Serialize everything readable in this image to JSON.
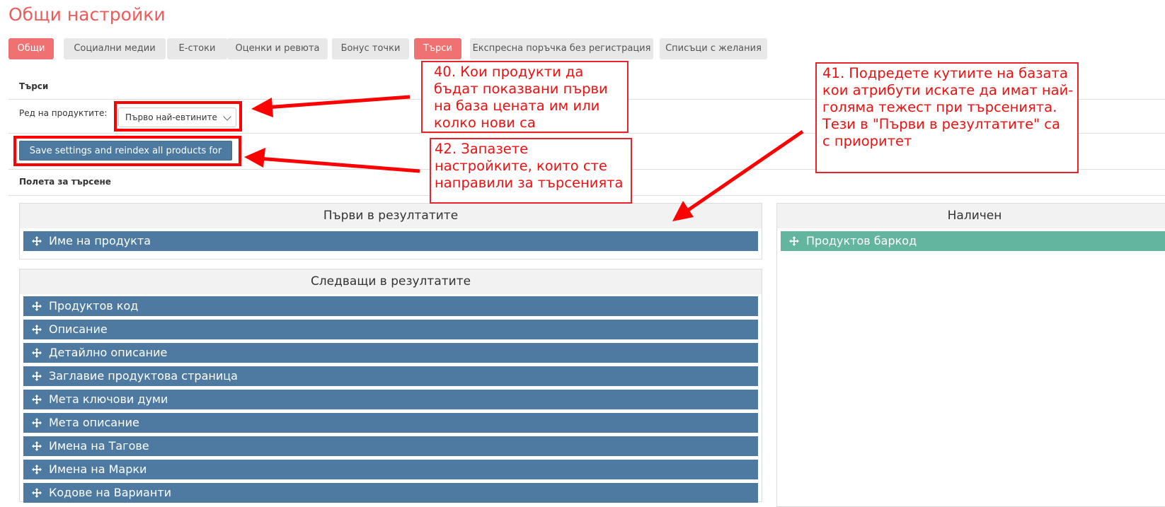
{
  "page": {
    "title": "Общи настройки"
  },
  "tabs": [
    {
      "label": "Общи",
      "active": true
    },
    {
      "label": "Социални медии",
      "active": false
    },
    {
      "label": "Е-стоки",
      "active": false
    },
    {
      "label": "Оценки и ревюта",
      "active": false
    },
    {
      "label": "Бонус точки",
      "active": false
    },
    {
      "label": "Търси",
      "active": true
    },
    {
      "label": "Експресна поръчка без регистрация",
      "active": false
    },
    {
      "label": "Списъци с желания",
      "active": false
    }
  ],
  "search_section": {
    "title": "Търси",
    "order_label": "Ред на продуктите:",
    "order_value": "Първо най-евтините",
    "save_button": "Save settings and reindex all products for search"
  },
  "fields_section": {
    "title": "Полета за търсене",
    "first_panel": {
      "title": "Първи в резултатите",
      "items": [
        "Име на продукта"
      ]
    },
    "next_panel": {
      "title": "Следващи в резултатите",
      "items": [
        "Продуктов код",
        "Описание",
        "Детайлно описание",
        "Заглавие продуктова страница",
        "Мета ключови думи",
        "Мета описание",
        "Имена на Тагове",
        "Имена на Марки",
        "Кодове на Варианти"
      ]
    },
    "available_panel": {
      "title": "Наличен",
      "items": [
        "Продуктов баркод"
      ]
    }
  },
  "annotations": {
    "note40": "40. Кои продукти да\nбъдат показвани първи\nна база цената им или\nколко нови са",
    "note41": "41. Подредете кутиите на базата\nкои атрибути искате да имат най-\nголяма тежест при търсенията.\nТези в \"Първи в резултатите\" са\nс приоритет",
    "note42": "42. Запазете\nнастройките, които сте\nнаправили за търсенията"
  },
  "colors": {
    "accent": "#f07171",
    "item_blue": "#4e7aa1",
    "item_green": "#64b5a0",
    "annotation_red": "#ff0000"
  }
}
